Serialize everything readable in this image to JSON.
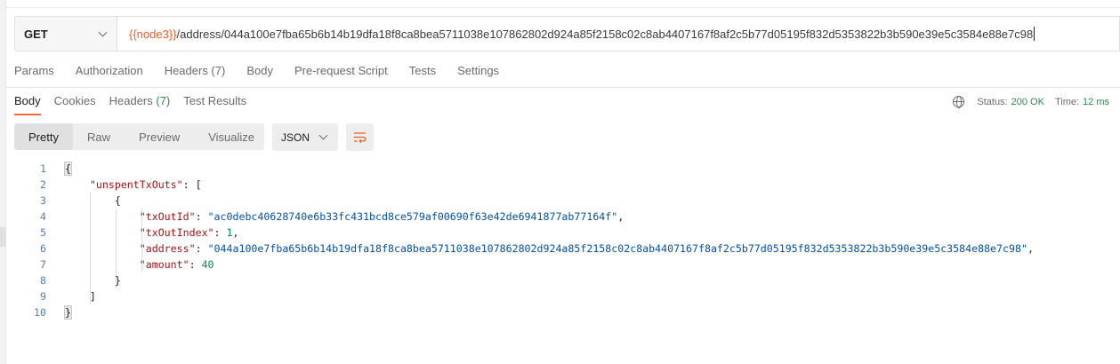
{
  "request": {
    "method": "GET",
    "url_variable": "{{node3}}",
    "url_path": "/address/044a100e7fba65b6b14b19dfa18f8ca8bea5711038e107862802d924a85f2158c02c8ab4407167f8af2c5b77d05195f832d5353822b3b590e39e5c3584e88e7c98"
  },
  "request_tabs": [
    {
      "label": "Params"
    },
    {
      "label": "Authorization"
    },
    {
      "label": "Headers (7)"
    },
    {
      "label": "Body"
    },
    {
      "label": "Pre-request Script"
    },
    {
      "label": "Tests"
    },
    {
      "label": "Settings"
    }
  ],
  "response_tabs": [
    {
      "label": "Body"
    },
    {
      "label": "Cookies"
    },
    {
      "label": "Headers",
      "count": "(7)"
    },
    {
      "label": "Test Results"
    }
  ],
  "status": {
    "status_label": "Status:",
    "status_value": "200 OK",
    "time_label": "Time:",
    "time_value": "12 ms"
  },
  "view_modes": [
    "Pretty",
    "Raw",
    "Preview",
    "Visualize"
  ],
  "format": "JSON",
  "code": {
    "line_numbers": [
      "1",
      "2",
      "3",
      "4",
      "5",
      "6",
      "7",
      "8",
      "9",
      "10"
    ],
    "key_unspent": "\"unspentTxOuts\"",
    "key_txOutId": "\"txOutId\"",
    "val_txOutId": "\"ac0debc40628740e6b33fc431bcd8ce579af00690f63e42de6941877ab77164f\"",
    "key_txOutIndex": "\"txOutIndex\"",
    "val_txOutIndex": "1",
    "key_address": "\"address\"",
    "val_address": "\"044a100e7fba65b6b14b19dfa18f8ca8bea5711038e107862802d924a85f2158c02c8ab4407167f8af2c5b77d05195f832d5353822b3b590e39e5c3584e88e7c98\"",
    "key_amount": "\"amount\"",
    "val_amount": "40"
  },
  "colors": {
    "accent": "#f26b3a",
    "variable": "#e8602a",
    "success": "#2a8c4a",
    "json_key": "#a31515",
    "json_string": "#0451a5",
    "json_number": "#098658"
  },
  "icons": {
    "method_dropdown": "chevron-down-icon",
    "format_dropdown": "chevron-down-icon",
    "wrap": "wrap-lines-icon",
    "network": "globe-icon"
  }
}
